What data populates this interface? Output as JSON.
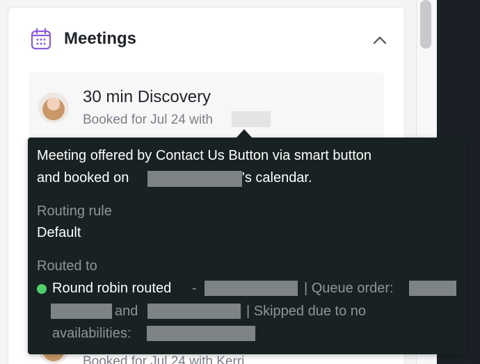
{
  "meetings_card": {
    "title": "Meetings",
    "icons": {
      "header": "calendar-icon",
      "collapse": "chevron-up-icon"
    },
    "meeting": {
      "title": "30 min Discovery",
      "booked_prefix": "Booked for Jul 24 with"
    },
    "next_meeting": {
      "booked_text": "Booked for Jul 24 with Kerri"
    }
  },
  "tooltip": {
    "line1": "Meeting offered by Contact Us Button via smart button",
    "line2_prefix": "and booked on",
    "line2_suffix": "'s calendar.",
    "routing_rule_label": "Routing rule",
    "routing_rule_value": "Default",
    "routed_to_label": "Routed to",
    "routed_method": "Round robin routed",
    "dash": "-",
    "queue_order_label": "| Queue order:",
    "and_text": "and",
    "skipped_text": "| Skipped due to no",
    "availabilities_label": "availabilities:",
    "status_color": "#4fd06b"
  }
}
